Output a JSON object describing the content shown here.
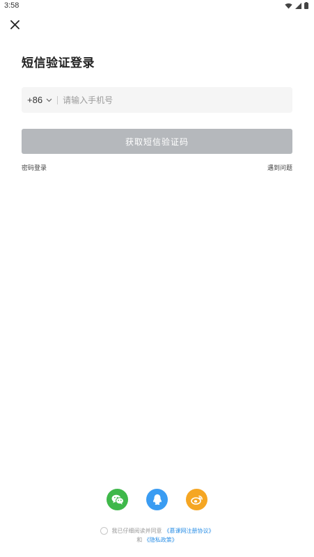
{
  "status_bar": {
    "time": "3:58",
    "icons": [
      "wifi-icon",
      "signal-icon",
      "battery-icon"
    ]
  },
  "header": {
    "close_icon": "close-icon"
  },
  "main": {
    "title": "短信验证登录",
    "country_code": "+86",
    "phone_placeholder": "请输入手机号",
    "phone_value": "",
    "get_code_button": "获取短信验证码",
    "password_login_link": "密码登录",
    "help_link": "遇到问题"
  },
  "social": {
    "items": [
      {
        "name": "wechat",
        "icon": "wechat-icon",
        "color": "#3fb84a"
      },
      {
        "name": "qq",
        "icon": "qq-icon",
        "color": "#3a9cf2"
      },
      {
        "name": "weibo",
        "icon": "weibo-icon",
        "color": "#f5a623"
      }
    ]
  },
  "agreement": {
    "prefix": "我已仔细阅读并同意",
    "terms_link": "《慕课网注册协议》",
    "and": "和",
    "privacy_link": "《隐私政策》"
  },
  "colors": {
    "button_disabled": "#b5b8bc",
    "link_blue": "#2b8fe6",
    "input_bg": "#f5f5f5"
  }
}
